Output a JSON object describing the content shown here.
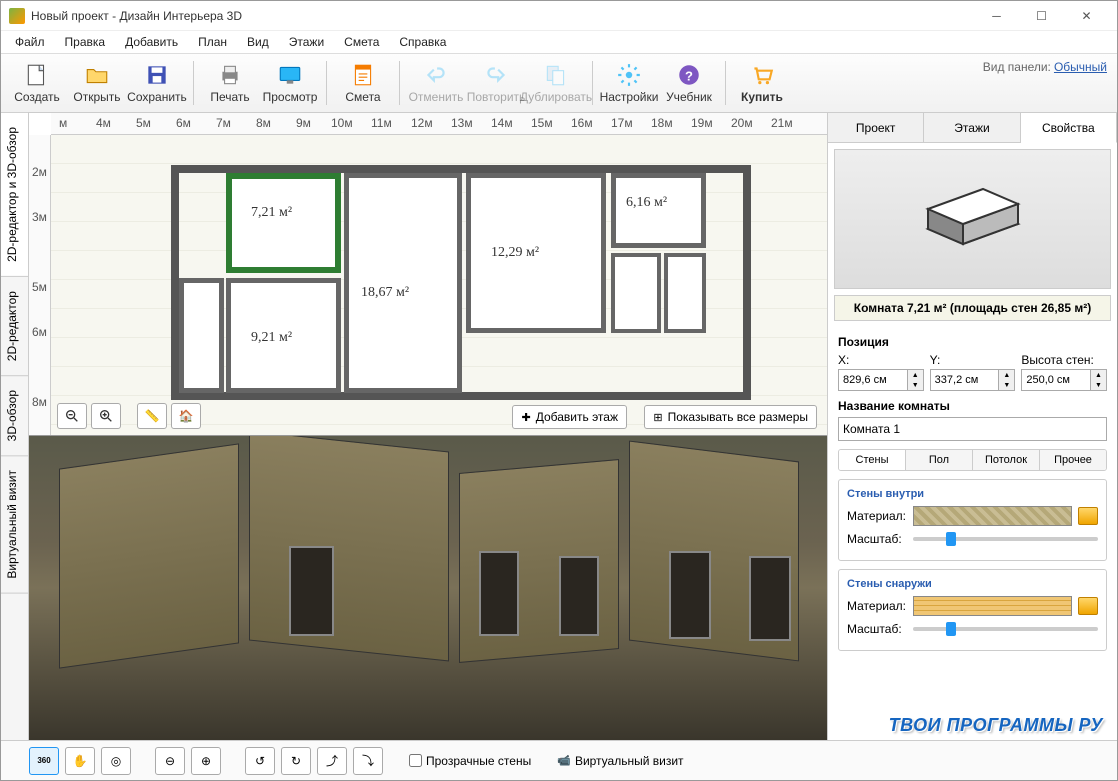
{
  "window": {
    "title": "Новый проект - Дизайн Интерьера 3D"
  },
  "menu": [
    "Файл",
    "Правка",
    "Добавить",
    "План",
    "Вид",
    "Этажи",
    "Смета",
    "Справка"
  ],
  "toolbar": {
    "create": "Создать",
    "open": "Открыть",
    "save": "Сохранить",
    "print": "Печать",
    "preview": "Просмотр",
    "estimate": "Смета",
    "undo": "Отменить",
    "redo": "Повторить",
    "duplicate": "Дублировать",
    "settings": "Настройки",
    "tutorial": "Учебник",
    "buy": "Купить",
    "panel_label": "Вид панели:",
    "panel_mode": "Обычный"
  },
  "left_tabs": [
    "2D-редактор и 3D-обзор",
    "2D-редактор",
    "3D-обзор",
    "Виртуальный визит"
  ],
  "ruler_h": [
    "м",
    "4м",
    "5м",
    "6м",
    "7м",
    "8м",
    "9м",
    "10м",
    "11м",
    "12м",
    "13м",
    "14м",
    "15м",
    "16м",
    "17м",
    "18м",
    "19м",
    "20м",
    "21м"
  ],
  "ruler_v": [
    "2м",
    "3м",
    "5м",
    "6м",
    "8м"
  ],
  "rooms": {
    "r1": "7,21 м²",
    "r2": "6,16 м²",
    "r3": "12,29 м²",
    "r4": "18,67 м²",
    "r5": "9,21 м²"
  },
  "plan_buttons": {
    "add_floor": "Добавить этаж",
    "show_dims": "Показывать все размеры"
  },
  "right_tabs": [
    "Проект",
    "Этажи",
    "Свойства"
  ],
  "room_info": "Комната 7,21 м²  (площадь стен 26,85 м²)",
  "props": {
    "position": "Позиция",
    "x": "X:",
    "y": "Y:",
    "wh": "Высота стен:",
    "xv": "829,6 см",
    "yv": "337,2 см",
    "whv": "250,0 см",
    "name_label": "Название комнаты",
    "name_value": "Комната 1"
  },
  "subtabs": [
    "Стены",
    "Пол",
    "Потолок",
    "Прочее"
  ],
  "walls": {
    "inside": "Стены внутри",
    "outside": "Стены снаружи",
    "material": "Материал:",
    "scale": "Масштаб:"
  },
  "bottom": {
    "transparent": "Прозрачные стены",
    "virtual": "Виртуальный визит"
  },
  "watermark": "ТВОИ ПРОГРАММЫ РУ"
}
